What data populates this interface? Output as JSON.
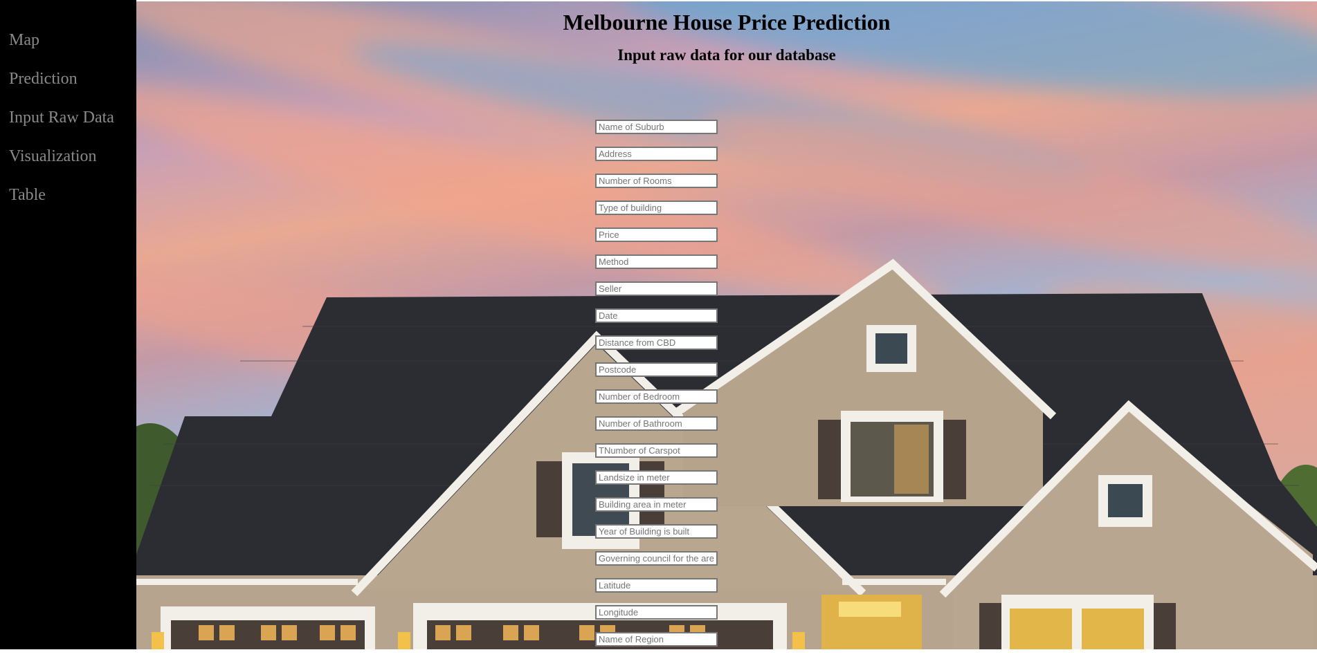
{
  "sidebar": {
    "items": [
      {
        "label": "Map"
      },
      {
        "label": "Prediction"
      },
      {
        "label": "Input Raw Data"
      },
      {
        "label": "Visualization"
      },
      {
        "label": "Table"
      }
    ]
  },
  "header": {
    "title": "Melbourne House Price Prediction",
    "subtitle": "Input raw data for our database"
  },
  "form": {
    "fields": [
      {
        "placeholder": "Name of Suburb",
        "value": ""
      },
      {
        "placeholder": "Address",
        "value": ""
      },
      {
        "placeholder": "Number of Rooms",
        "value": ""
      },
      {
        "placeholder": "Type of building",
        "value": ""
      },
      {
        "placeholder": "Price",
        "value": ""
      },
      {
        "placeholder": "Method",
        "value": ""
      },
      {
        "placeholder": "Seller",
        "value": ""
      },
      {
        "placeholder": "Date",
        "value": ""
      },
      {
        "placeholder": "Distance from CBD",
        "value": ""
      },
      {
        "placeholder": "Postcode",
        "value": ""
      },
      {
        "placeholder": "Number of Bedroom",
        "value": ""
      },
      {
        "placeholder": "Number of Bathroom",
        "value": ""
      },
      {
        "placeholder": "TNumber of Carspot",
        "value": ""
      },
      {
        "placeholder": "Landsize in meter",
        "value": ""
      },
      {
        "placeholder": "Building area in meter",
        "value": ""
      },
      {
        "placeholder": "Year of Building is built",
        "value": ""
      },
      {
        "placeholder": "Governing council for the area",
        "value": ""
      },
      {
        "placeholder": "Latitude",
        "value": ""
      },
      {
        "placeholder": "Longitude",
        "value": ""
      },
      {
        "placeholder": "Name of Region",
        "value": ""
      }
    ]
  },
  "background": {
    "image": "house-at-sunset-photo",
    "sidebar_color": "#000000",
    "nav_text_color": "#8a8a8a"
  }
}
